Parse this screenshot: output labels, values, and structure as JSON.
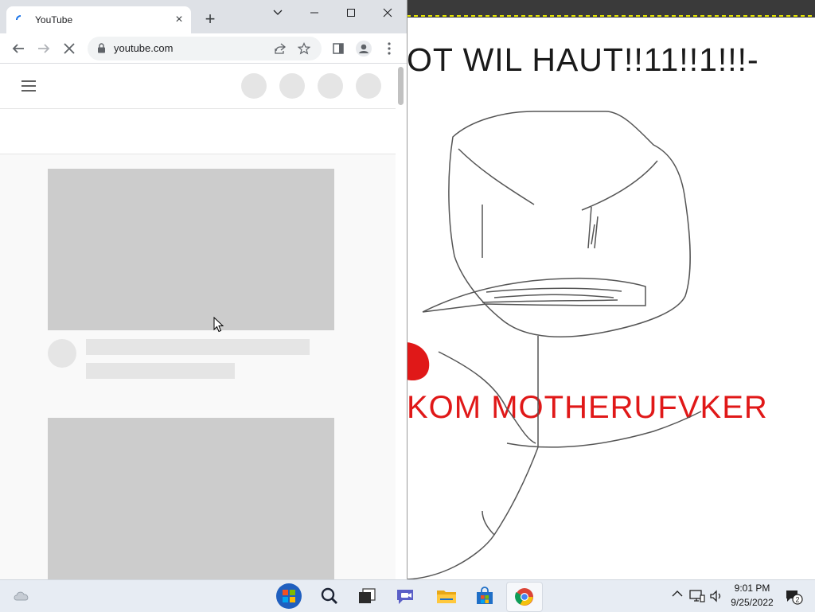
{
  "browser": {
    "tab_title": "YouTube",
    "new_tab_glyph": "+",
    "tab_close_glyph": "×",
    "url": "youtube.com"
  },
  "background_image": {
    "top_text": "OT WIL HAUT!!11!!1!!!-",
    "red_text": "KOM MOTHERUFVKER"
  },
  "taskbar": {
    "time": "9:01 PM",
    "date": "9/25/2022",
    "notification_count": "2",
    "apps": [
      "start-button",
      "search",
      "task-view",
      "chat",
      "file-explorer",
      "microsoft-store",
      "google-chrome"
    ]
  },
  "colors": {
    "tab_bar": "#dee1e6",
    "skeleton_dark": "#cccccc",
    "skeleton_light": "#e5e5e5",
    "taskbar": "#e7ecf3",
    "red_text": "#e01818"
  }
}
